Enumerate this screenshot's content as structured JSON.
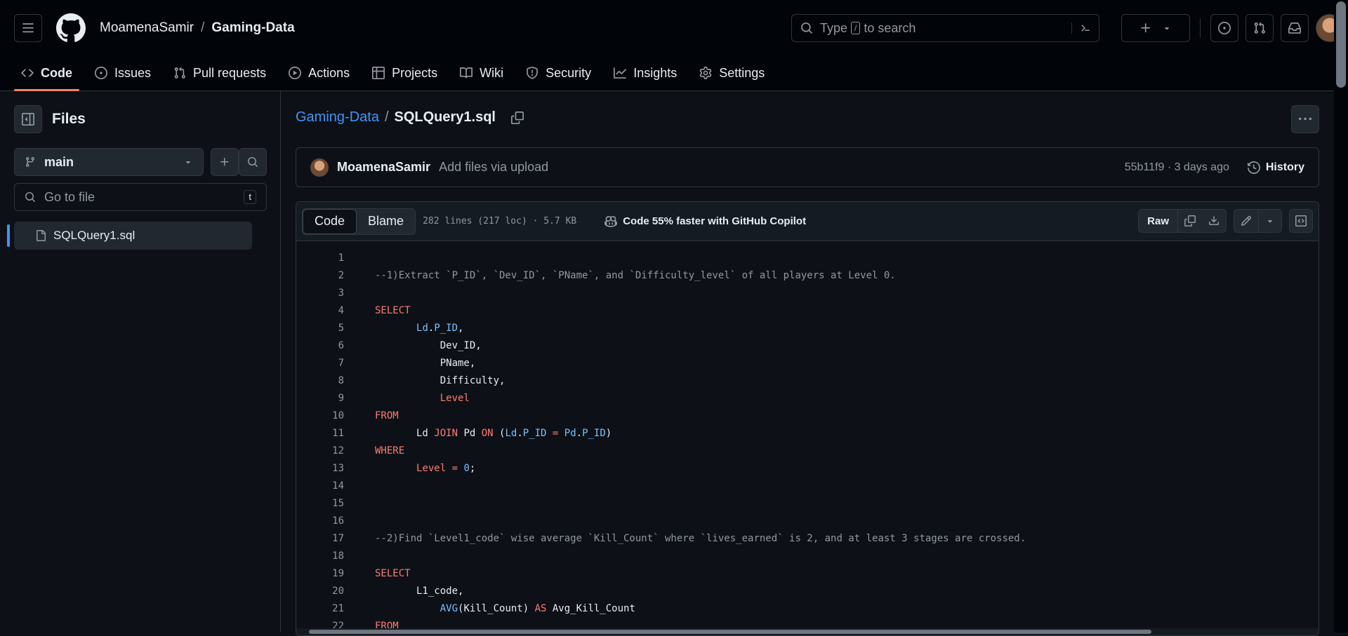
{
  "header": {
    "owner": "MoamenaSamir",
    "separator": "/",
    "repo": "Gaming-Data",
    "search": {
      "prefix": "Type",
      "key": "/",
      "suffix": "to search"
    }
  },
  "tabs": [
    {
      "label": "Code",
      "icon": "code-icon"
    },
    {
      "label": "Issues",
      "icon": "issue-opened-icon"
    },
    {
      "label": "Pull requests",
      "icon": "git-pull-request-icon"
    },
    {
      "label": "Actions",
      "icon": "play-icon"
    },
    {
      "label": "Projects",
      "icon": "table-icon"
    },
    {
      "label": "Wiki",
      "icon": "book-icon"
    },
    {
      "label": "Security",
      "icon": "shield-icon"
    },
    {
      "label": "Insights",
      "icon": "graph-icon"
    },
    {
      "label": "Settings",
      "icon": "gear-icon"
    }
  ],
  "sidebar": {
    "title": "Files",
    "branch": "main",
    "goto_placeholder": "Go to file",
    "goto_key": "t",
    "file": "SQLQuery1.sql"
  },
  "main": {
    "repo": "Gaming-Data",
    "separator": "/",
    "file": "SQLQuery1.sql",
    "commit": {
      "author": "MoamenaSamir",
      "message": "Add files via upload",
      "meta": "55b11f9 · 3 days ago",
      "history": "History"
    },
    "viewer": {
      "tab_code": "Code",
      "tab_blame": "Blame",
      "lines_info": "282 lines (217 loc) · 5.7 KB",
      "copilot": "Code 55% faster with GitHub Copilot",
      "raw": "Raw"
    }
  },
  "colors": {
    "keyword": "#ff7b72",
    "identifier": "#79c0ff",
    "comment": "#9198a1",
    "accent": "#4493f8",
    "tab_underline": "#f78166"
  },
  "code_lines": [
    [],
    [
      [
        "cm",
        "--1)Extract `P_ID`, `Dev_ID`, `PName`, and `Difficulty_level` of all players at Level 0."
      ]
    ],
    [],
    [
      [
        "kw",
        "SELECT"
      ]
    ],
    [
      [
        "tx",
        "       "
      ],
      [
        "id",
        "Ld"
      ],
      [
        "tx",
        "."
      ],
      [
        "id",
        "P_ID"
      ],
      [
        "tx",
        ","
      ]
    ],
    [
      [
        "tx",
        "           Dev_ID,"
      ]
    ],
    [
      [
        "tx",
        "           PName,"
      ]
    ],
    [
      [
        "tx",
        "           Difficulty,"
      ]
    ],
    [
      [
        "tx",
        "           "
      ],
      [
        "kw",
        "Level"
      ]
    ],
    [
      [
        "kw",
        "FROM"
      ]
    ],
    [
      [
        "tx",
        "       Ld "
      ],
      [
        "kw",
        "JOIN"
      ],
      [
        "tx",
        " Pd "
      ],
      [
        "kw",
        "ON"
      ],
      [
        "tx",
        " ("
      ],
      [
        "id",
        "Ld"
      ],
      [
        "tx",
        "."
      ],
      [
        "id",
        "P_ID"
      ],
      [
        "tx",
        " "
      ],
      [
        "kw",
        "="
      ],
      [
        "tx",
        " "
      ],
      [
        "id",
        "Pd"
      ],
      [
        "tx",
        "."
      ],
      [
        "id",
        "P_ID"
      ],
      [
        "tx",
        ")"
      ]
    ],
    [
      [
        "kw",
        "WHERE"
      ]
    ],
    [
      [
        "tx",
        "       "
      ],
      [
        "kw",
        "Level"
      ],
      [
        "tx",
        " "
      ],
      [
        "kw",
        "="
      ],
      [
        "tx",
        " "
      ],
      [
        "id",
        "0"
      ],
      [
        "tx",
        ";"
      ]
    ],
    [],
    [],
    [],
    [
      [
        "cm",
        "--2)Find `Level1_code` wise average `Kill_Count` where `lives_earned` is 2, and at least 3 stages are crossed."
      ]
    ],
    [],
    [
      [
        "kw",
        "SELECT"
      ]
    ],
    [
      [
        "tx",
        "       L1_code,"
      ]
    ],
    [
      [
        "tx",
        "           "
      ],
      [
        "id",
        "AVG"
      ],
      [
        "tx",
        "(Kill_Count) "
      ],
      [
        "kw",
        "AS"
      ],
      [
        "tx",
        " Avg_Kill_Count"
      ]
    ],
    [
      [
        "kw",
        "FROM"
      ]
    ]
  ]
}
